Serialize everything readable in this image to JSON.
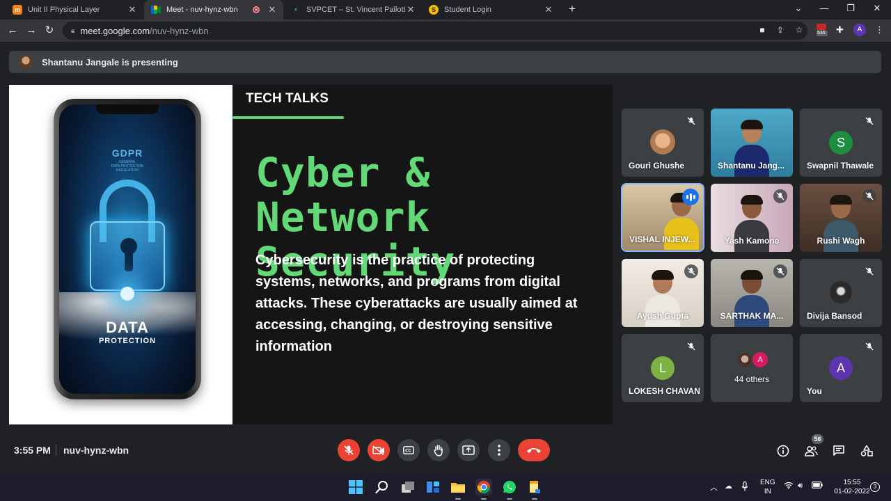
{
  "browser": {
    "tabs": [
      {
        "title": "Unit II Physical Layer",
        "favicon": "moodle-icon",
        "active": false
      },
      {
        "title": "Meet - nuv-hynz-wbn",
        "favicon": "meet-icon",
        "active": true
      },
      {
        "title": "SVPCET – St. Vincent Pallotti Colle",
        "favicon": "svpcet-icon",
        "active": false
      },
      {
        "title": "Student Login",
        "favicon": "student-icon",
        "active": false
      }
    ],
    "url_host": "meet.google.com",
    "url_path": "/nuv-hynz-wbn",
    "extension_badge": "535",
    "profile_initial": "A"
  },
  "meet": {
    "presenter_banner": "Shantanu Jangale is presenting",
    "slide": {
      "header": "TECH TALKS",
      "title_line1": "Cyber & Network",
      "title_line2": "Security",
      "body": "Cybersecurity is the practice of protecting systems, networks, and programs from digital attacks. These cyberattacks are usually aimed at accessing, changing, or destroying sensitive information",
      "image_text": {
        "gdpr": "GDPR",
        "gdpr_sub1": "GENERAL",
        "gdpr_sub2": "DATA PROTECTION",
        "gdpr_sub3": "REGULATION",
        "data": "DATA",
        "protection": "PROTECTION"
      }
    },
    "participants": [
      {
        "name": "Gouri Ghushe",
        "kind": "photo",
        "muted": true
      },
      {
        "name": "Shantanu Jang...",
        "kind": "video",
        "muted": false
      },
      {
        "name": "Swapnil Thawale",
        "kind": "letter",
        "letter": "S",
        "color": "#1e8e3e",
        "muted": true
      },
      {
        "name": "VISHAL INJEW...",
        "kind": "video",
        "muted": false,
        "speaking": true
      },
      {
        "name": "Yash Kamone",
        "kind": "video",
        "muted": true
      },
      {
        "name": "Rushi Wagh",
        "kind": "video",
        "muted": true
      },
      {
        "name": "Ayush Gupta",
        "kind": "video",
        "muted": true
      },
      {
        "name": "SARTHAK MA...",
        "kind": "video",
        "muted": true
      },
      {
        "name": "Divija Bansod",
        "kind": "photo",
        "muted": true
      },
      {
        "name": "LOKESH CHAVAN",
        "kind": "letter",
        "letter": "L",
        "color": "#7cb342",
        "muted": true
      },
      {
        "name": "44 others",
        "kind": "others",
        "muted": false,
        "others_letter": "A"
      },
      {
        "name": "You",
        "kind": "letter",
        "letter": "A",
        "color": "#5e35b1",
        "muted": true
      }
    ],
    "time": "3:55 PM",
    "meeting_code": "nuv-hynz-wbn",
    "people_count": "56",
    "colors": {
      "end_call": "#ea4335",
      "accent_green": "#62d976",
      "speaking_blue": "#1a73e8"
    }
  },
  "taskbar": {
    "lang_top": "ENG",
    "lang_bottom": "IN",
    "time": "15:55",
    "date": "01-02-2022",
    "notifications": "3"
  }
}
